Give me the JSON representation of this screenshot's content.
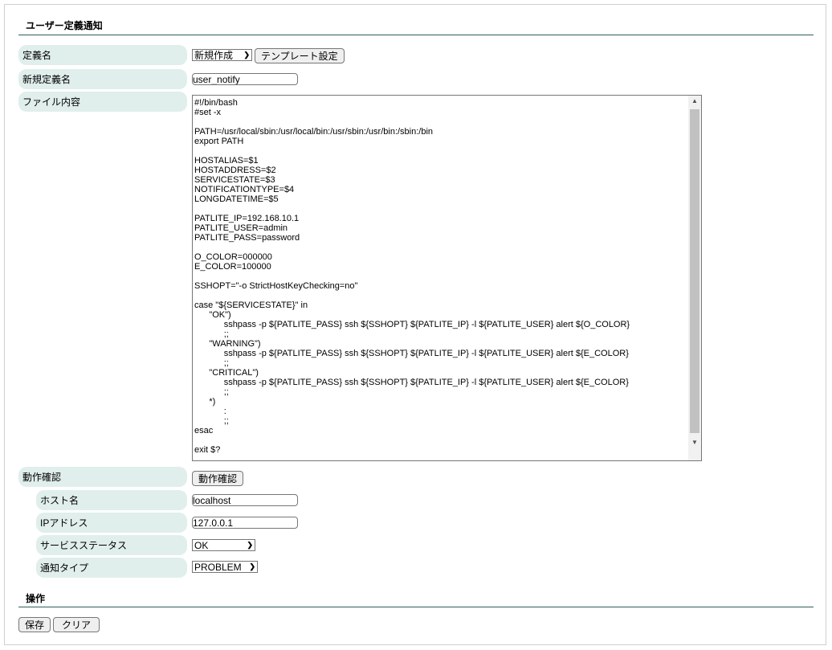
{
  "title": "ユーザー定義通知",
  "rows": {
    "def_name": {
      "label": "定義名",
      "select_value": "新規作成",
      "template_button": "テンプレート設定"
    },
    "new_def_name": {
      "label": "新規定義名",
      "value": "user_notify"
    },
    "file_content": {
      "label": "ファイル内容",
      "value": "#!/bin/bash\n#set -x\n\nPATH=/usr/local/sbin:/usr/local/bin:/usr/sbin:/usr/bin:/sbin:/bin\nexport PATH\n\nHOSTALIAS=$1\nHOSTADDRESS=$2\nSERVICESTATE=$3\nNOTIFICATIONTYPE=$4\nLONGDATETIME=$5\n\nPATLITE_IP=192.168.10.1\nPATLITE_USER=admin\nPATLITE_PASS=password\n\nO_COLOR=000000\nE_COLOR=100000\n\nSSHOPT=\"-o StrictHostKeyChecking=no\"\n\ncase \"${SERVICESTATE}\" in\n\t\"OK\")\n\t\tsshpass -p ${PATLITE_PASS} ssh ${SSHOPT} ${PATLITE_IP} -l ${PATLITE_USER} alert ${O_COLOR}\n\t\t;;\n\t\"WARNING\")\n\t\tsshpass -p ${PATLITE_PASS} ssh ${SSHOPT} ${PATLITE_IP} -l ${PATLITE_USER} alert ${E_COLOR}\n\t\t;;\n\t\"CRITICAL\")\n\t\tsshpass -p ${PATLITE_PASS} ssh ${SSHOPT} ${PATLITE_IP} -l ${PATLITE_USER} alert ${E_COLOR}\n\t\t;;\n\t*)\n\t\t:\n\t\t;;\nesac\n\nexit $?"
    },
    "test": {
      "label": "動作確認",
      "button": "動作確認"
    },
    "host": {
      "label": "ホスト名",
      "value": "localhost"
    },
    "ip": {
      "label": "IPアドレス",
      "value": "127.0.0.1"
    },
    "service_status": {
      "label": "サービスステータス",
      "value": "OK"
    },
    "notify_type": {
      "label": "通知タイプ",
      "value": "PROBLEM"
    }
  },
  "actions": {
    "heading": "操作",
    "save": "保存",
    "clear": "クリア"
  },
  "colors": {
    "label_bg": "#e0eeec",
    "rule": "#2f5f5a"
  }
}
